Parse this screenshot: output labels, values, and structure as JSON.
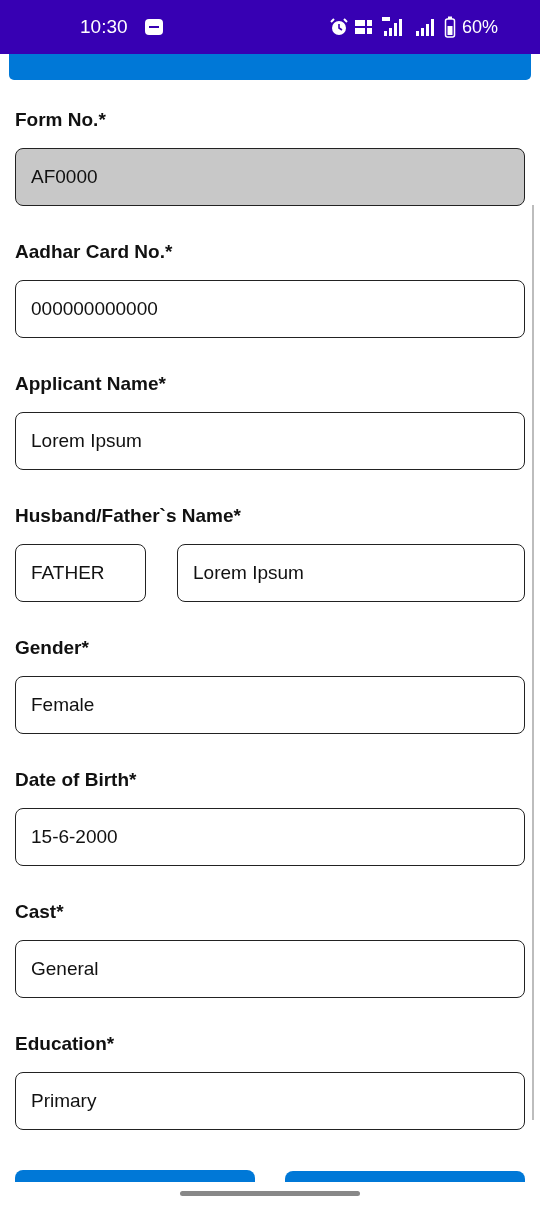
{
  "status_bar": {
    "time": "10:30",
    "battery": "60%"
  },
  "fields": [
    {
      "kind": "single",
      "label": "Form No.*",
      "values": [
        "AF0000"
      ],
      "disabled": true
    },
    {
      "kind": "single",
      "label": "Aadhar Card No.*",
      "values": [
        "000000000000"
      ],
      "disabled": false
    },
    {
      "kind": "single",
      "label": "Applicant Name*",
      "values": [
        "Lorem Ipsum"
      ],
      "disabled": false
    },
    {
      "kind": "pair",
      "label": "Husband/Father`s Name*",
      "values": [
        "FATHER",
        "Lorem Ipsum"
      ],
      "disabled": false
    },
    {
      "kind": "single",
      "label": "Gender*",
      "values": [
        "Female"
      ],
      "disabled": false
    },
    {
      "kind": "single",
      "label": "Date of Birth*",
      "values": [
        "15-6-2000"
      ],
      "disabled": false
    },
    {
      "kind": "single",
      "label": "Cast*",
      "values": [
        "General"
      ],
      "disabled": false
    },
    {
      "kind": "single",
      "label": "Education*",
      "values": [
        "Primary"
      ],
      "disabled": false
    }
  ]
}
